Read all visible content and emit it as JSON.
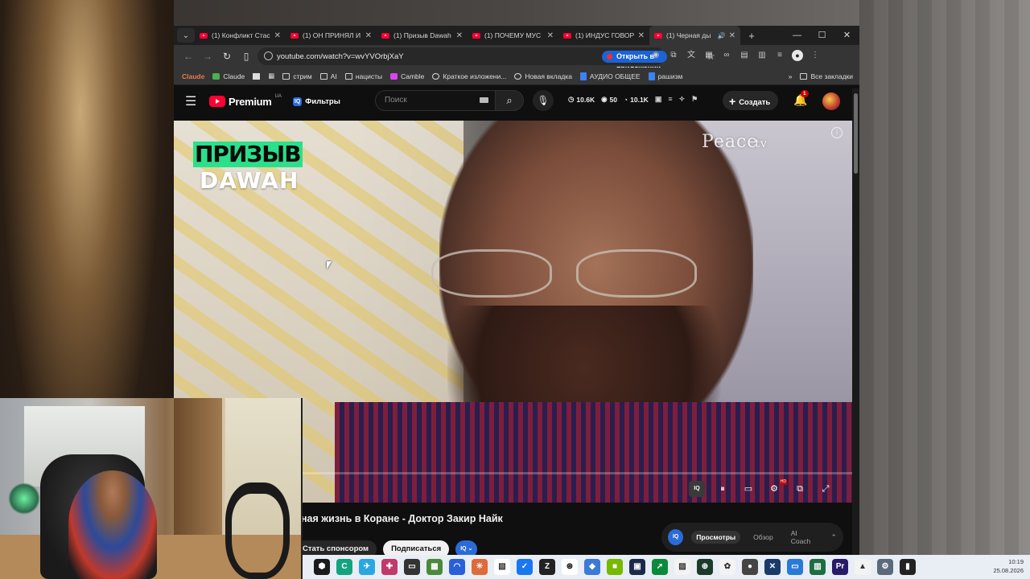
{
  "browser": {
    "tabs": [
      {
        "title": "(1) Конфликт Стас",
        "active": false
      },
      {
        "title": "(1) ОН ПРИНЯЛ И",
        "active": false
      },
      {
        "title": "(1) Призыв Dawah",
        "active": false
      },
      {
        "title": "(1) ПОЧЕМУ МУС",
        "active": false
      },
      {
        "title": "(1) ИНДУС ГОВОР",
        "active": false
      },
      {
        "title": "(1) Черная ды",
        "active": true
      }
    ],
    "url": "youtube.com/watch?v=wvYVOrbjXaY",
    "open_in_app_label": "Открыть в приложении",
    "bookmarks": [
      {
        "label": "Claude",
        "icon": "claude-icon"
      },
      {
        "label": "Claude",
        "icon": "green-square-icon"
      },
      {
        "label": "стрим",
        "icon": "folder-icon"
      },
      {
        "label": "AI",
        "icon": "folder-icon"
      },
      {
        "label": "нацисты",
        "icon": "folder-icon"
      },
      {
        "label": "Camble",
        "icon": "camble-icon"
      },
      {
        "label": "Краткое изложени...",
        "icon": "round-icon"
      },
      {
        "label": "Новая вкладка",
        "icon": "round-icon"
      },
      {
        "label": "АУДИО ОБЩЕЕ",
        "icon": "doc-icon"
      },
      {
        "label": "рашизм",
        "icon": "doc-icon"
      }
    ],
    "all_bookmarks_label": "Все закладки"
  },
  "youtube": {
    "brand": "Premium",
    "region": "UA",
    "filters_label": "Фильтры",
    "search_placeholder": "Поиск",
    "stats": [
      {
        "icon": "clock-icon",
        "value": "10.6K"
      },
      {
        "icon": "eye-icon",
        "value": "50"
      },
      {
        "icon": "timer-icon",
        "value": "10.1K"
      }
    ],
    "create_label": "Создать",
    "notification_count": "1",
    "video": {
      "overlay_line1": "ПРИЗЫВ",
      "overlay_line2": "DAWAH",
      "watermark": "Peace",
      "watermark_suffix": "tv",
      "progress_percent": 0
    },
    "title": "ная жизнь в Коране - Доктор Закир Найк",
    "action_chips": [
      "Стать спонсором",
      "Подписаться"
    ],
    "iq_panel": {
      "tabs": [
        "Просмотры",
        "Обзор",
        "AI Coach"
      ],
      "active_tab": "Просмотры"
    }
  },
  "taskbar": {
    "time": "10:19",
    "date": "25.08.2026"
  }
}
